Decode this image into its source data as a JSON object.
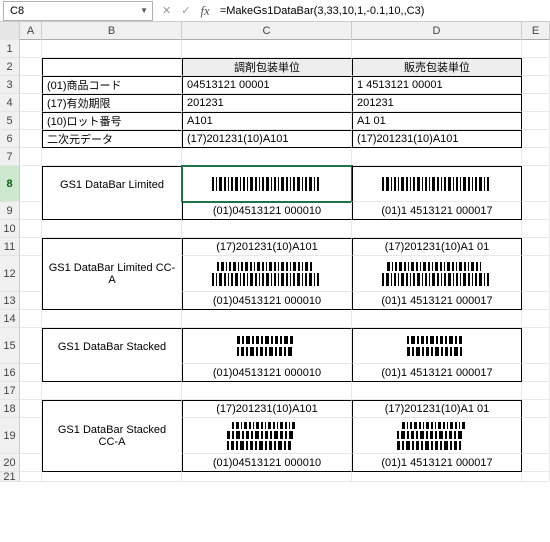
{
  "nameBox": "C8",
  "formula": "=MakeGs1DataBar(3,33,10,1,-0.1,10,,C3)",
  "colHeaders": [
    "",
    "A",
    "B",
    "C",
    "D",
    "E"
  ],
  "rowNumbers": [
    "1",
    "2",
    "3",
    "4",
    "5",
    "6",
    "7",
    "8",
    "9",
    "10",
    "11",
    "12",
    "13",
    "14",
    "15",
    "16",
    "17",
    "18",
    "19",
    "20",
    "21"
  ],
  "activeRow": "8",
  "table1": {
    "headerC": "調剤包装単位",
    "headerD": "販売包装単位",
    "rows": [
      {
        "label": "(01)商品コード",
        "c": "04513121 00001",
        "d": "1 4513121 00001"
      },
      {
        "label": "(17)有効期限",
        "c": "201231",
        "d": "201231"
      },
      {
        "label": "(10)ロット番号",
        "c": "A101",
        "d": "A1 01"
      },
      {
        "label": "二次元データ",
        "c": "(17)201231(10)A101",
        "d": "(17)201231(10)A101"
      }
    ]
  },
  "blocks": [
    {
      "label": "GS1 DataBar Limited",
      "rows": [
        {
          "c_type": "barcode",
          "d_type": "barcode"
        },
        {
          "c": "(01)04513121 000010",
          "d": "(01)1 4513121 000017"
        }
      ]
    },
    {
      "label": "GS1 DataBar Limited CC-A",
      "rows": [
        {
          "c": "(17)201231(10)A101",
          "d": "(17)201231(10)A1 01"
        },
        {
          "c_type": "barcode2",
          "d_type": "barcode2"
        },
        {
          "c": "(01)04513121 000010",
          "d": "(01)1 4513121 000017"
        }
      ]
    },
    {
      "label": "GS1 DataBar Stacked",
      "rows": [
        {
          "c_type": "barcode3",
          "d_type": "barcode3"
        },
        {
          "c": "(01)04513121 000010",
          "d": "(01)1 4513121 000017"
        }
      ]
    },
    {
      "label": "GS1 DataBar Stacked CC-A",
      "rows": [
        {
          "c": "(17)201231(10)A101",
          "d": "(17)201231(10)A1 01"
        },
        {
          "c_type": "barcode4",
          "d_type": "barcode4"
        },
        {
          "c": "(01)04513121 000010",
          "d": "(01)1 4513121 000017"
        }
      ]
    }
  ]
}
